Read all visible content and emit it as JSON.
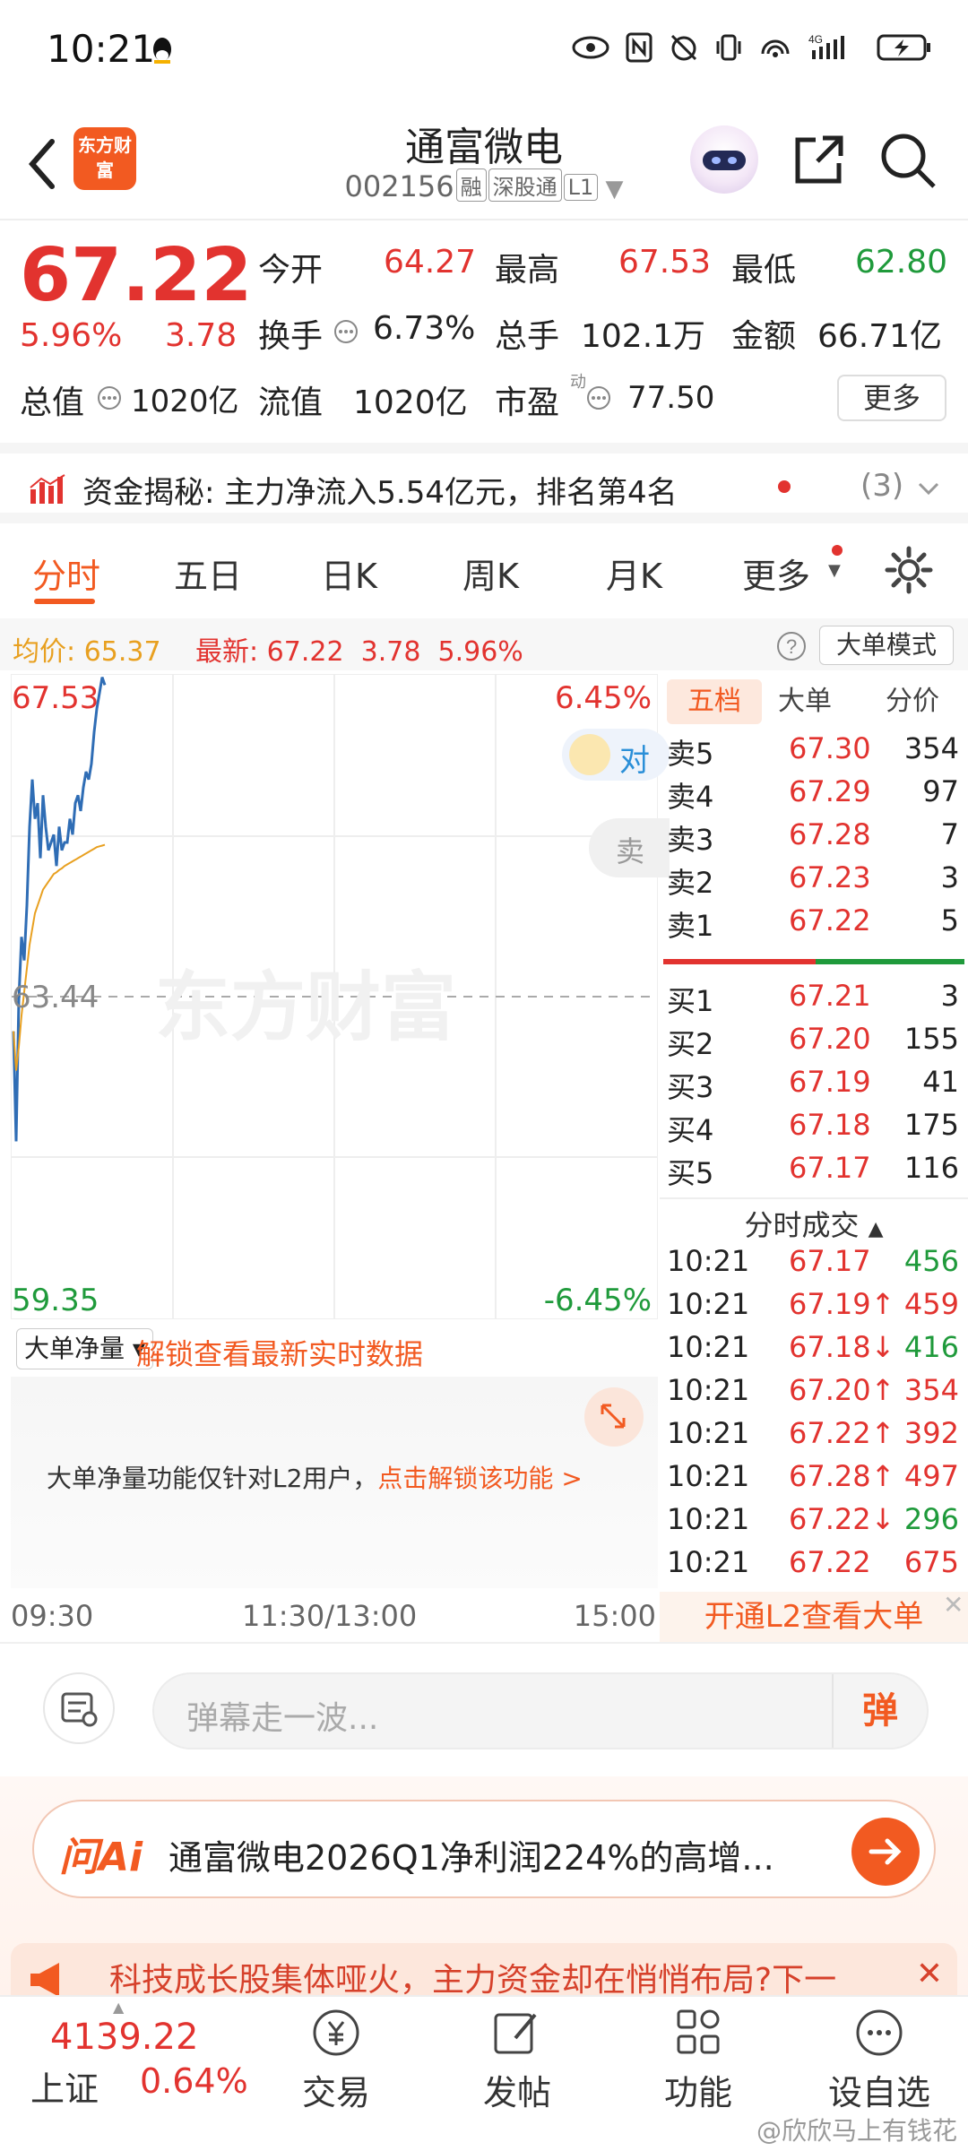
{
  "status_bar": {
    "time": "10:21",
    "network": "4G",
    "sim": "1"
  },
  "header": {
    "logo_text": "东方财富",
    "stock_name": "通富微电",
    "stock_code": "002156",
    "tags": [
      "融",
      "深股通",
      "L1"
    ]
  },
  "quote": {
    "price": "67.22",
    "change_pct": "5.96%",
    "change": "3.78",
    "open_label": "今开",
    "open": "64.27",
    "high_label": "最高",
    "high": "67.53",
    "low_label": "最低",
    "low": "62.80",
    "turnover_label": "换手",
    "turnover": "6.73%",
    "volume_label": "总手",
    "volume": "102.1万",
    "amount_label": "金额",
    "amount": "66.71亿",
    "mktcap_label": "总值",
    "mktcap": "1020亿",
    "float_label": "流值",
    "float_cap": "1020亿",
    "pe_label": "市盈",
    "pe_sup": "动",
    "pe": "77.50",
    "more_label": "更多"
  },
  "fund_flow": {
    "label": "资金揭秘:",
    "text": "主力净流入5.54亿元，排名第4名",
    "count": "(3)"
  },
  "tabs": [
    "分时",
    "五日",
    "日K",
    "周K",
    "月K",
    "更多"
  ],
  "avg_line": {
    "avg_label": "均价:",
    "avg": "65.37",
    "latest_label": "最新:",
    "latest": "67.22",
    "change": "3.78",
    "pct": "5.96%",
    "mode_label": "大单模式"
  },
  "chart_labels": {
    "top_price": "67.53",
    "top_pct": "6.45%",
    "mid_price": "63.44",
    "bottom_price": "59.35",
    "bottom_pct": "-6.45%",
    "watermark": "东方财富",
    "float_chip": "对",
    "float_chip2": "卖"
  },
  "chart_data": {
    "type": "line",
    "ylim": [
      59.35,
      67.53
    ],
    "series": [
      {
        "values": [
          63.0,
          61.6,
          63.4,
          64.2,
          63.9,
          64.6,
          65.6,
          66.2,
          65.7,
          65.9,
          65.2,
          66.0,
          65.6,
          65.3,
          65.4,
          65.5,
          65.1,
          65.6,
          65.3,
          65.4,
          65.4,
          65.7,
          65.5,
          65.9,
          66.0,
          65.8,
          66.1,
          66.3,
          66.2,
          66.4,
          66.8,
          67.1,
          67.3,
          67.5,
          67.4
        ]
      },
      {
        "values": [
          63.0,
          62.5,
          62.8,
          63.2,
          63.5,
          63.8,
          64.1,
          64.3,
          64.5,
          64.6,
          64.7,
          64.8,
          64.85,
          64.9,
          64.95,
          65.0,
          65.02,
          65.05,
          65.07,
          65.1,
          65.12,
          65.14,
          65.16,
          65.18,
          65.2,
          65.22,
          65.24,
          65.26,
          65.28,
          65.3,
          65.32,
          65.34,
          65.35,
          65.36,
          65.37
        ]
      }
    ],
    "colors": {
      "price_line": "#2f6db5",
      "avg_line": "#e8a020"
    }
  },
  "order_book": {
    "tabs": [
      "五档",
      "大单",
      "分价"
    ],
    "asks": [
      {
        "label": "卖5",
        "price": "67.30",
        "vol": "354"
      },
      {
        "label": "卖4",
        "price": "67.29",
        "vol": "97"
      },
      {
        "label": "卖3",
        "price": "67.28",
        "vol": "7"
      },
      {
        "label": "卖2",
        "price": "67.23",
        "vol": "3"
      },
      {
        "label": "卖1",
        "price": "67.22",
        "vol": "5"
      }
    ],
    "bids": [
      {
        "label": "买1",
        "price": "67.21",
        "vol": "3"
      },
      {
        "label": "买2",
        "price": "67.20",
        "vol": "155"
      },
      {
        "label": "买3",
        "price": "67.19",
        "vol": "41"
      },
      {
        "label": "买4",
        "price": "67.18",
        "vol": "175"
      },
      {
        "label": "买5",
        "price": "67.17",
        "vol": "116"
      }
    ]
  },
  "ticks": {
    "title": "分时成交",
    "rows": [
      {
        "time": "10:21",
        "price": "67.17",
        "arrow": "",
        "vol": "456",
        "dir": "green"
      },
      {
        "time": "10:21",
        "price": "67.19",
        "arrow": "↑",
        "vol": "459",
        "dir": "red"
      },
      {
        "time": "10:21",
        "price": "67.18",
        "arrow": "↓",
        "vol": "416",
        "dir": "green"
      },
      {
        "time": "10:21",
        "price": "67.20",
        "arrow": "↑",
        "vol": "354",
        "dir": "red"
      },
      {
        "time": "10:21",
        "price": "67.22",
        "arrow": "↑",
        "vol": "392",
        "dir": "red"
      },
      {
        "time": "10:21",
        "price": "67.28",
        "arrow": "↑",
        "vol": "497",
        "dir": "red"
      },
      {
        "time": "10:21",
        "price": "67.22",
        "arrow": "↓",
        "vol": "296",
        "dir": "green"
      },
      {
        "time": "10:21",
        "price": "67.22",
        "arrow": "",
        "vol": "675",
        "dir": "red"
      }
    ],
    "l2_label": "开通L2查看大单"
  },
  "net_panel": {
    "select_label": "大单净量",
    "unlock_label": "解锁查看最新实时数据",
    "msg": "大单净量功能仅针对L2用户，",
    "msg_link": "点击解锁该功能 >"
  },
  "time_axis": [
    "09:30",
    "11:30/13:00",
    "15:00"
  ],
  "danmu": {
    "placeholder": "弹幕走一波...",
    "button": "弹"
  },
  "ai": {
    "logo": "问Ai",
    "text": "通富微电2026Q1净利润224%的高增..."
  },
  "banner": {
    "text": "科技成长股集体哑火，主力资金却在悄悄布局?下一"
  },
  "bottom_nav": {
    "index_value": "4139.22",
    "index_name": "上证",
    "index_pct": "0.64%",
    "items": [
      "交易",
      "发帖",
      "功能",
      "设自选"
    ]
  },
  "watermark": "@欣欣马上有钱花"
}
